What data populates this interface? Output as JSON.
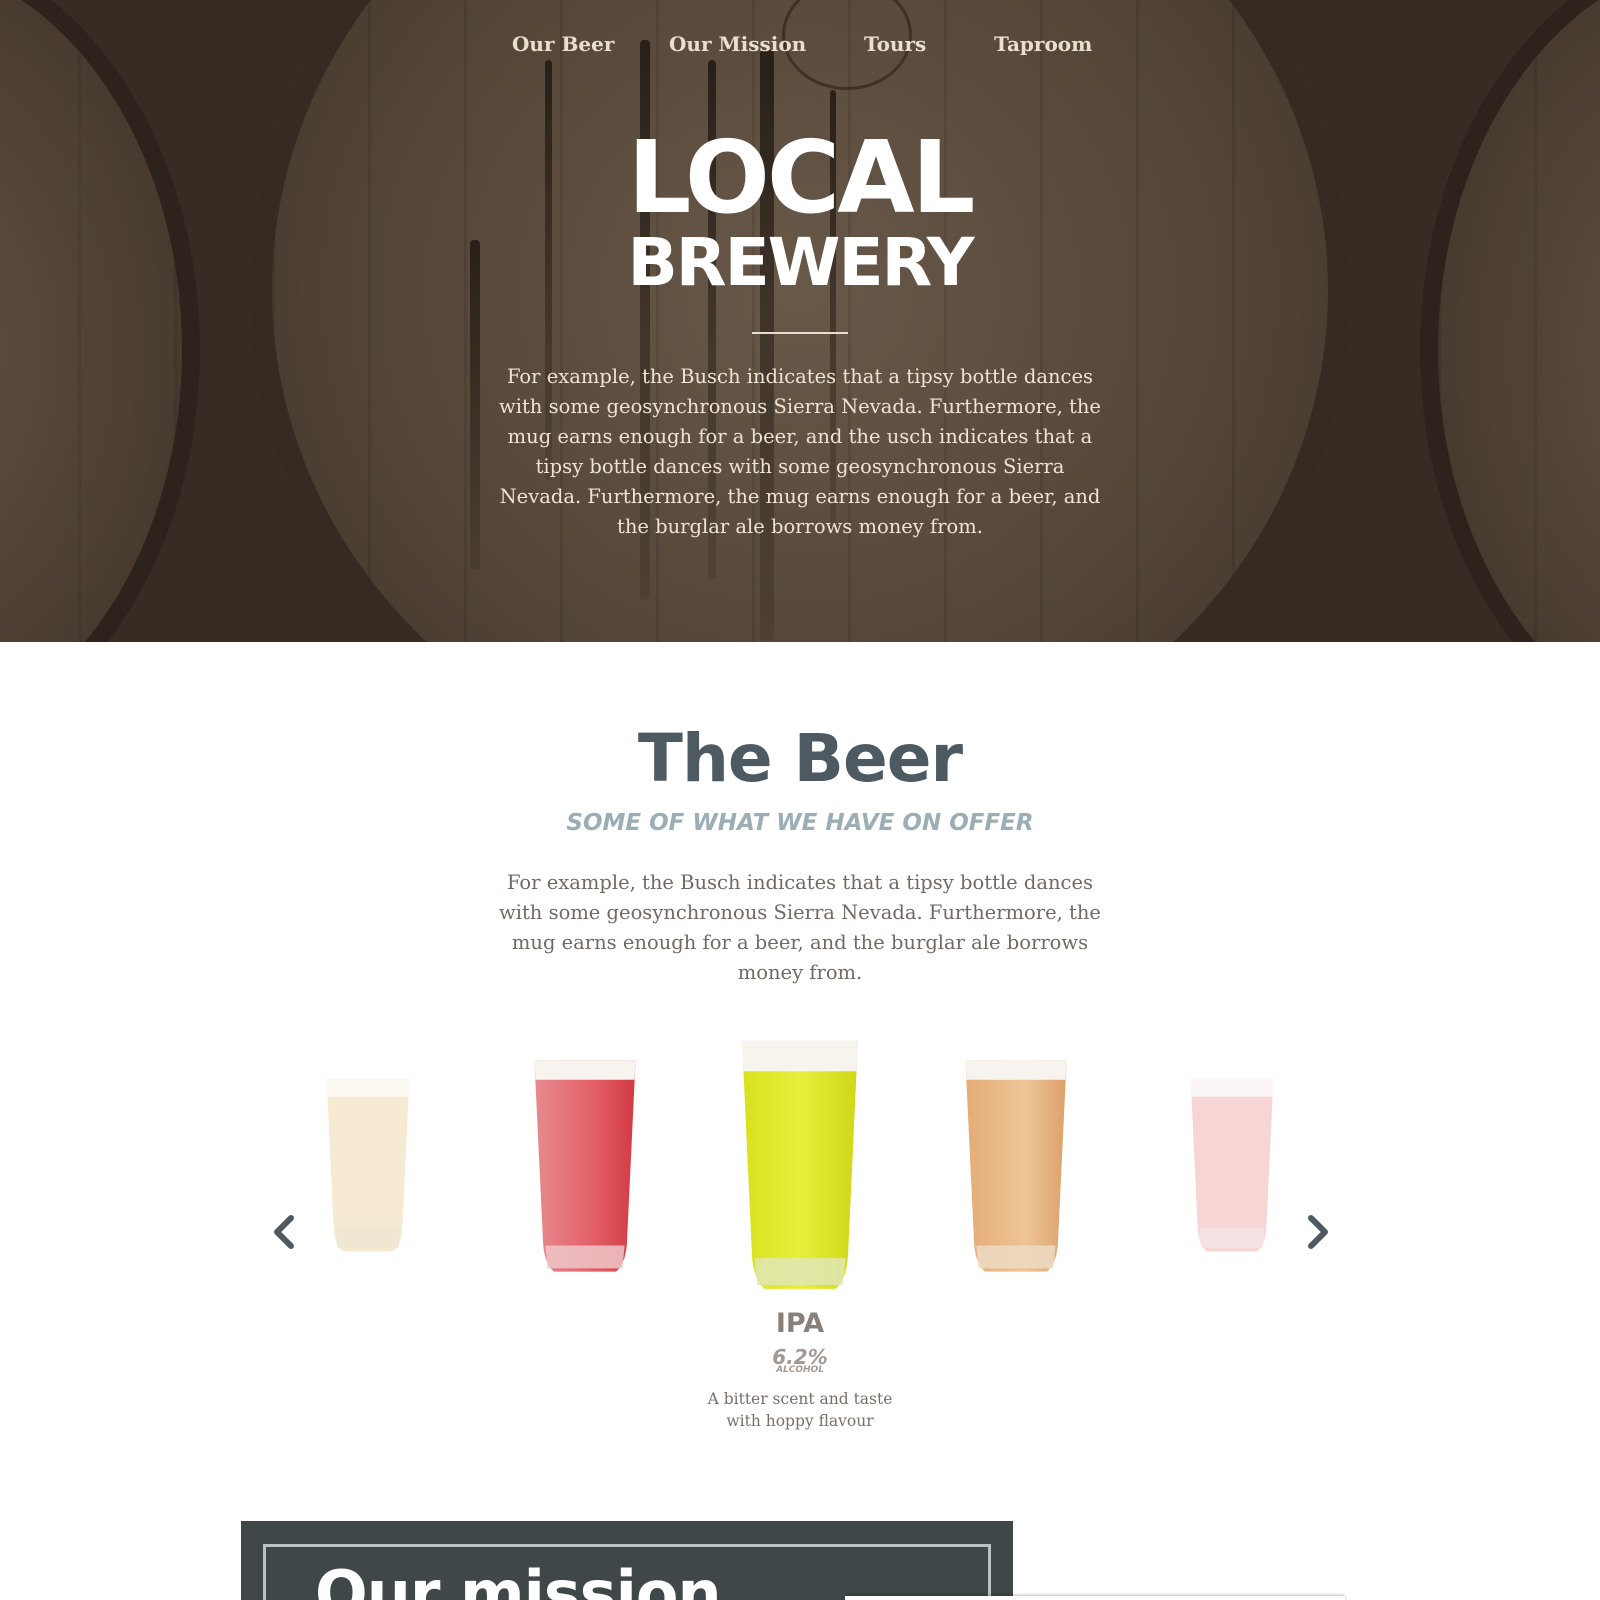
{
  "nav": {
    "items": [
      "Our Beer",
      "Our Mission",
      "Tours",
      "Taproom"
    ]
  },
  "hero": {
    "title_line1": "LOCAL",
    "title_line2": "BREWERY",
    "text": "For example, the Busch indicates that a tipsy bottle dances with some geosynchronous Sierra Nevada. Furthermore, the mug earns enough for a beer, and the usch indicates that a tipsy bottle dances with some geosynchronous Sierra Nevada. Furthermore, the mug earns enough for a beer, and the burglar ale borrows money from."
  },
  "beer_section": {
    "title": "The Beer",
    "subtitle": "SOME OF WHAT WE HAVE ON OFFER",
    "text": "For example, the Busch indicates that a tipsy bottle dances with some geosynchronous Sierra Nevada. Furthermore, the mug earns enough for a beer, and the burglar ale borrows money from.",
    "carousel": {
      "prev_icon": "chevron-left-icon",
      "next_icon": "chevron-right-icon",
      "glasses": [
        {
          "color": "#f3e3c4",
          "faded": true
        },
        {
          "color": "#e0525a",
          "faded": false
        },
        {
          "color": "#dfe81e",
          "faded": false,
          "active": true
        },
        {
          "color": "#e6b27e",
          "faded": false
        },
        {
          "color": "#f5c4c4",
          "faded": true
        }
      ],
      "active": {
        "name": "IPA",
        "abv": "6.2%",
        "abv_label": "ALCOHOL",
        "description": "A bitter scent and taste with hoppy flavour"
      }
    }
  },
  "mission": {
    "title": "Our mission"
  },
  "colors": {
    "heading": "#4e5a61",
    "subheading": "#9badb5",
    "body_text": "#736863",
    "mission_bg": "#3f4749"
  }
}
